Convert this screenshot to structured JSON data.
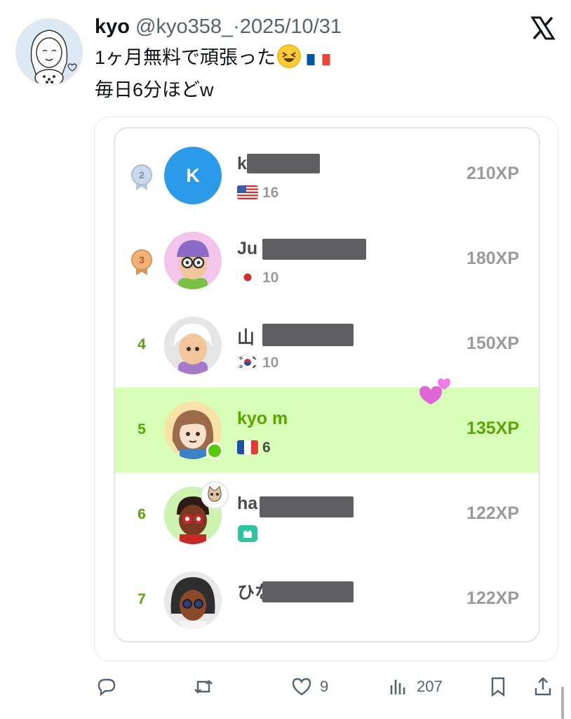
{
  "tweet": {
    "display_name": "kyo",
    "handle": "@kyo358_",
    "separator": "·",
    "date": "2025/10/31",
    "line1": "1ヶ月無料で頑張った",
    "line2": "毎日6分ほどw",
    "icons": [
      "laughing-emoji",
      "france-flag-emoji",
      "x-logo-icon"
    ]
  },
  "leaderboard": {
    "rows": [
      {
        "rank": "2",
        "name": "k",
        "flag": "us",
        "value": "16",
        "xp": "210XP",
        "medal": "silver"
      },
      {
        "rank": "3",
        "name": "Ju",
        "flag": "jp",
        "value": "10",
        "xp": "180XP",
        "medal": "bronze"
      },
      {
        "rank": "4",
        "name": "山",
        "flag": "kr",
        "value": "10",
        "xp": "150XP"
      },
      {
        "rank": "5",
        "name": "kyo m",
        "flag": "fr",
        "value": "6",
        "xp": "135XP",
        "highlight": true
      },
      {
        "rank": "6",
        "name": "ha",
        "badge": "castle-icon",
        "xp": "122XP"
      },
      {
        "rank": "7",
        "name": "ひな",
        "xp": "122XP"
      }
    ],
    "colors": {
      "green": "#58a700",
      "highlight": "#d7ffb8",
      "gray_text": "#9a9a9a"
    }
  },
  "actions": {
    "reply_label": "",
    "retweet_label": "",
    "like_count": "9",
    "views_count": "207"
  }
}
